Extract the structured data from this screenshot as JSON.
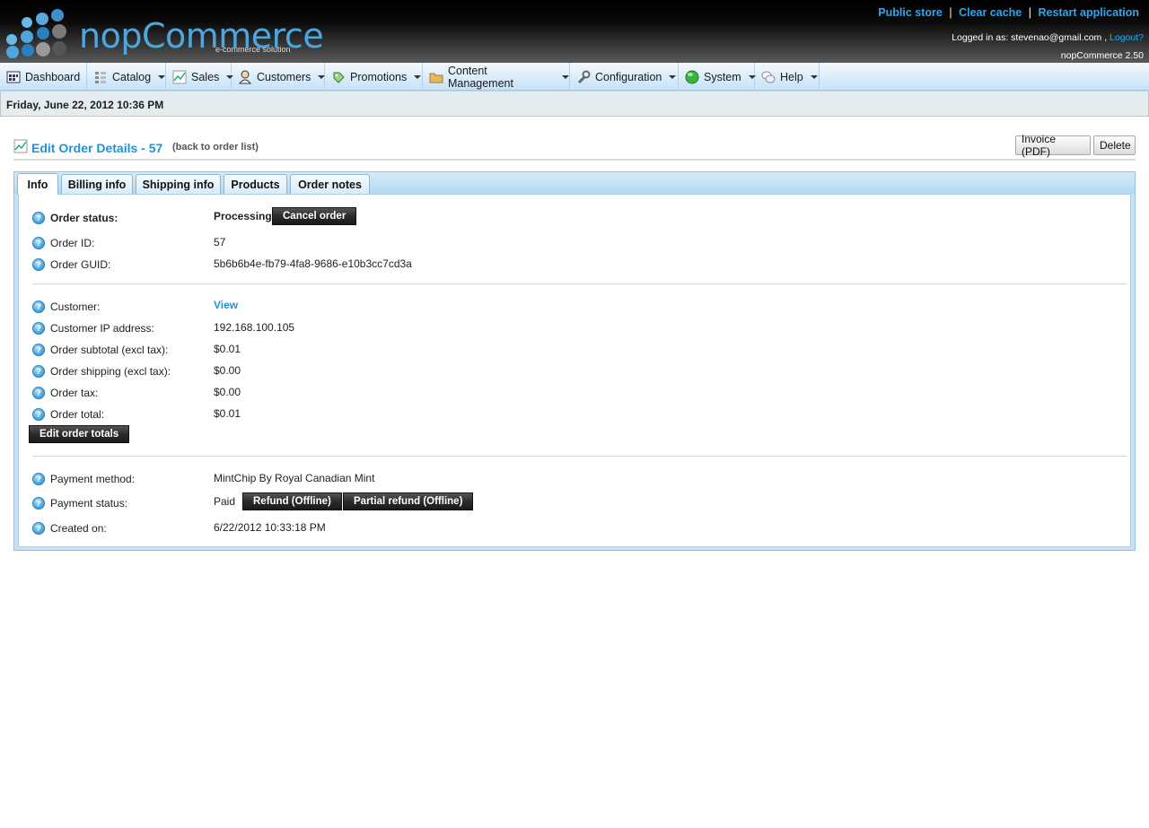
{
  "header": {
    "logo_text": "nopCommerce",
    "logo_subtitle": "e-commerce solution",
    "links": {
      "public_store": "Public store",
      "clear_cache": "Clear cache",
      "restart": "Restart application",
      "separator": "|"
    },
    "logged_in_prefix": "Logged in as: stevenao@gmail.com ,",
    "logout": "Logout?",
    "version": "nopCommerce 2.50"
  },
  "menu": [
    {
      "label": "Dashboard",
      "icon": "dashboard-icon",
      "dropdown": false
    },
    {
      "label": "Catalog",
      "icon": "catalog-icon",
      "dropdown": true
    },
    {
      "label": "Sales",
      "icon": "sales-chart-icon",
      "dropdown": true
    },
    {
      "label": "Customers",
      "icon": "customer-icon",
      "dropdown": true
    },
    {
      "label": "Promotions",
      "icon": "tag-icon",
      "dropdown": true
    },
    {
      "label": "Content Management",
      "icon": "folder-icon",
      "dropdown": true
    },
    {
      "label": "Configuration",
      "icon": "wrench-icon",
      "dropdown": true
    },
    {
      "label": "System",
      "icon": "green-ball-icon",
      "dropdown": true
    },
    {
      "label": "Help",
      "icon": "chat-bubbles-icon",
      "dropdown": true
    }
  ],
  "date_bar": "Friday, June 22, 2012 10:36 PM",
  "page": {
    "title": "Edit Order Details - 57",
    "back_link": "(back to order list)",
    "buttons": {
      "invoice": "Invoice (PDF)",
      "delete": "Delete"
    }
  },
  "tabs": [
    "Info",
    "Billing info",
    "Shipping info",
    "Products",
    "Order notes"
  ],
  "active_tab": "Info",
  "info": {
    "order_status_label": "Order status:",
    "order_status_value": "Processing",
    "cancel_order": "Cancel order",
    "order_id_label": "Order ID:",
    "order_id_value": "57",
    "order_guid_label": "Order GUID:",
    "order_guid_value": "5b6b6b4e-fb79-4fa8-9686-e10b3cc7cd3a",
    "customer_label": "Customer:",
    "customer_value": "View",
    "ip_label": "Customer IP address:",
    "ip_value": "192.168.100.105",
    "subtotal_label": "Order subtotal (excl tax):",
    "subtotal_value": "$0.01",
    "shipping_label": "Order shipping (excl tax):",
    "shipping_value": "$0.00",
    "tax_label": "Order tax:",
    "tax_value": "$0.00",
    "total_label": "Order total:",
    "total_value": "$0.01",
    "edit_totals": "Edit order totals",
    "payment_method_label": "Payment method:",
    "payment_method_value": "MintChip By Royal Canadian Mint",
    "payment_status_label": "Payment status:",
    "payment_status_value": "Paid",
    "refund": "Refund (Offline)",
    "partial_refund": "Partial refund (Offline)",
    "created_label": "Created on:",
    "created_value": "6/22/2012 10:33:18 PM",
    "help_glyph": "?"
  },
  "colors": {
    "accent_blue": "#1a94de",
    "link_blue": "#2aa7ef",
    "dark_button": "#2b2b2b"
  }
}
